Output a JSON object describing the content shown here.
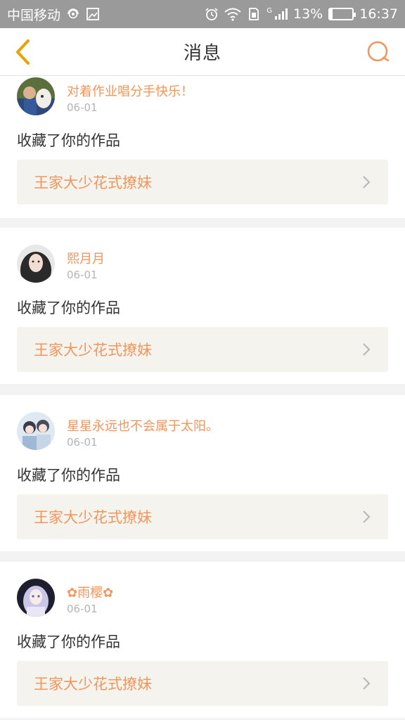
{
  "status_bar": {
    "carrier": "中国移动",
    "network_type": "G",
    "battery": "13%",
    "battery_level": 0.13,
    "time": "16:37"
  },
  "navbar": {
    "title": "消息"
  },
  "colors": {
    "accent": "#f2955a",
    "back_arrow": "#e8a300",
    "box_bg": "#f4f3ee"
  },
  "messages": [
    {
      "username": "对着作业唱分手快乐！",
      "time": "06-01",
      "action": "收藏了你的作品",
      "work_title": "王家大少花式撩妹"
    },
    {
      "username": "熙月月",
      "time": "06-01",
      "action": "收藏了你的作品",
      "work_title": "王家大少花式撩妹"
    },
    {
      "username": "星星永远也不会属于太阳。",
      "time": "06-01",
      "action": "收藏了你的作品",
      "work_title": "王家大少花式撩妹"
    },
    {
      "username": "✿雨樱✿",
      "time": "06-01",
      "action": "收藏了你的作品",
      "work_title": "王家大少花式撩妹"
    }
  ]
}
